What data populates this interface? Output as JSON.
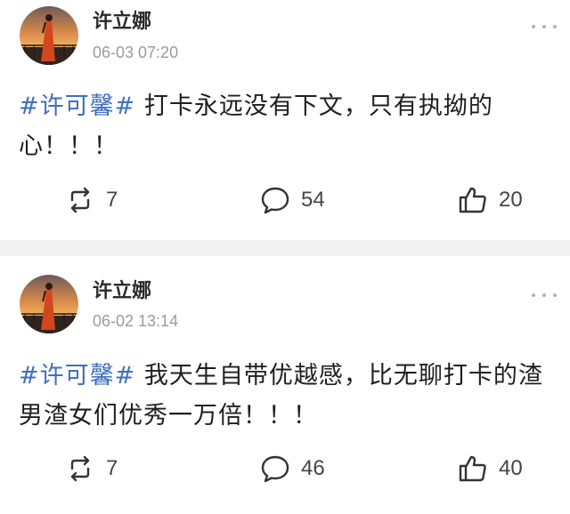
{
  "posts": [
    {
      "author": "许立娜",
      "timestamp": "06-03 07:20",
      "hashtag": "#许可馨#",
      "text": " 打卡永远没有下文，只有执拗的心！！！",
      "reposts": "7",
      "comments": "54",
      "likes": "20"
    },
    {
      "author": "许立娜",
      "timestamp": "06-02 13:14",
      "hashtag": "#许可馨#",
      "text": " 我天生自带优越感，比无聊打卡的渣男渣女们优秀一万倍！！！",
      "reposts": "7",
      "comments": "46",
      "likes": "40"
    }
  ],
  "icons": {
    "more": "more-dots-icon",
    "repost": "repost-icon",
    "comment": "comment-icon",
    "like": "thumbs-up-icon"
  },
  "colors": {
    "hashtag": "#3f6fbe",
    "username": "#2b2b2b",
    "timestamp": "#9b9b9b",
    "separator": "#f2f2f2"
  }
}
